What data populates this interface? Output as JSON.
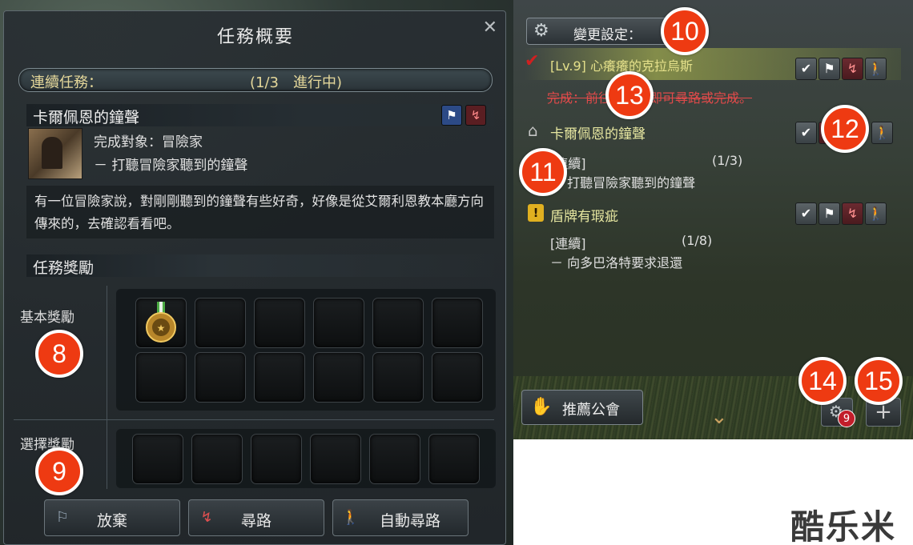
{
  "left_panel": {
    "title": "任務概要",
    "close_icon": "✕",
    "series": {
      "label": "連續任務：",
      "progress": "(1/3　進行中)"
    },
    "quest": {
      "title": "卡爾佩恩的鐘聲",
      "icons": [
        "flag-icon",
        "path-icon"
      ],
      "target": "完成對象：冒險家",
      "objective": "－ 打聽冒險家聽到的鐘聲",
      "description": "有一位冒險家說，對剛剛聽到的鐘聲有些好奇，好像是從艾爾利恩教本廳方向傳來的，去確認看看吧。"
    },
    "rewards": {
      "heading": "任務獎勵",
      "basic_label": "基本獎勵",
      "choice_label": "選擇獎勵"
    },
    "buttons": {
      "abandon": "放棄",
      "navigate": "尋路",
      "auto_navigate": "自動尋路"
    }
  },
  "right_panel": {
    "settings_label": "變更設定：",
    "quests": [
      {
        "title": "[Lv.9] 心癢癢的克拉烏斯",
        "status": "完成：前往對話處即可尋路或完成。"
      },
      {
        "title": "卡爾佩恩的鐘聲",
        "series": "[連續]",
        "progress": "(1/3)",
        "objective": "－ 打聽冒險家聽到的鐘聲"
      },
      {
        "title": "盾牌有瑕疵",
        "series": "[連續]",
        "progress": "(1/8)",
        "objective": "－ 向多巴洛特要求退還"
      }
    ],
    "guild_button": "推薦公會",
    "gear_badge": "9",
    "plus_label": "+"
  },
  "markers": [
    "8",
    "9",
    "10",
    "11",
    "12",
    "13",
    "14",
    "15"
  ],
  "watermark": "酷乐米",
  "colors": {
    "marker": "#ee3a12",
    "quest_title_yellow": "#e4d79a",
    "complete_red": "#e14a4a",
    "badge_red": "#c21e2a"
  }
}
